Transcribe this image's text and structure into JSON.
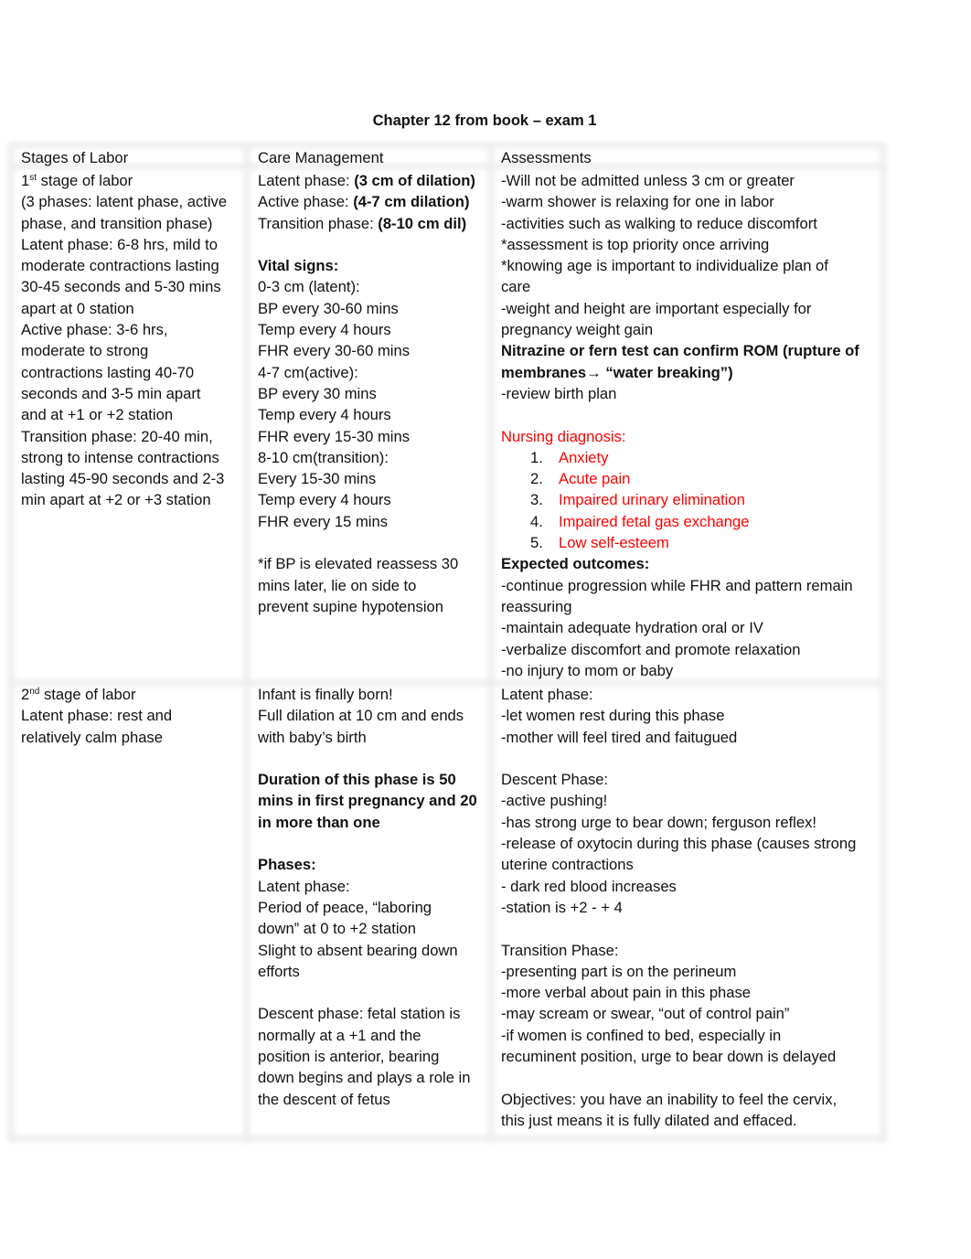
{
  "document": {
    "title": "Chapter 12 from book – exam 1"
  },
  "table": {
    "headers": [
      "Stages of Labor",
      "Care Management",
      "Assessments"
    ],
    "row1": {
      "stage": {
        "stage_num": "1",
        "stage_sup": "st",
        "stage_rest": " stage of labor",
        "lines": [
          "(3 phases: latent phase, active",
          "phase, and transition phase)",
          "Latent phase: 6-8 hrs, mild to",
          "moderate contractions lasting",
          "30-45 seconds and 5-30 mins",
          "apart at 0 station",
          "Active phase: 3-6 hrs,",
          "moderate to strong",
          "contractions lasting 40-70",
          "seconds and 3-5 min apart",
          "and at +1 or +2 station",
          "Transition phase: 20-40 min,",
          "strong to intense contractions",
          "lasting 45-90 seconds and 2-3",
          "min apart at +2 or +3 station"
        ]
      },
      "care": {
        "phases": [
          {
            "label": "Latent phase: ",
            "value": "(3 cm of dilation)"
          },
          {
            "label": "Active phase: ",
            "value": "(4-7 cm dilation)"
          },
          {
            "label": "Transition phase: ",
            "value": "(8-10 cm dil)"
          }
        ],
        "vitals_heading": "Vital signs:",
        "vitals": [
          "0-3 cm (latent):",
          "BP every 30-60 mins",
          "Temp every 4 hours",
          "FHR every 30-60 mins",
          "4-7 cm(active):",
          "BP every 30 mins",
          "Temp every 4 hours",
          "FHR every 15-30 mins",
          "8-10 cm(transition):",
          "Every 15-30 mins",
          "Temp every 4 hours",
          "FHR every 15 mins"
        ],
        "note": [
          "*if BP is elevated reassess 30",
          "mins later, lie on side to",
          "prevent supine hypotension"
        ]
      },
      "assess": {
        "lines": [
          "-Will not be admitted unless 3 cm or greater",
          "-warm shower is relaxing for one in labor",
          "-activities such as walking to reduce discomfort",
          "*assessment is top priority once arriving",
          "*knowing age is important to individualize plan of",
          "care",
          "-weight and height are important especially for",
          "pregnancy weight gain"
        ],
        "bold_line1": "Nitrazine or fern test can confirm ROM (rupture of",
        "bold_line2a": "membranes",
        "arrow": "→",
        "bold_line2b": " “water breaking”)",
        "review": "-review birth plan",
        "nursing_heading": "Nursing diagnosis:",
        "nursing_diagnoses": [
          {
            "num": "1.",
            "text": "Anxiety"
          },
          {
            "num": "2.",
            "text": "Acute pain"
          },
          {
            "num": "3.",
            "text": "Impaired urinary elimination"
          },
          {
            "num": "4.",
            "text": "Impaired fetal gas exchange"
          },
          {
            "num": "5.",
            "text": "Low self-esteem"
          }
        ],
        "outcomes_heading": "Expected outcomes:",
        "outcomes": [
          "-continue progression while FHR and pattern remain",
          "reassuring",
          "-maintain adequate hydration oral or IV",
          "-verbalize discomfort and promote relaxation",
          "-no injury to mom or baby"
        ]
      }
    },
    "row2": {
      "stage": {
        "stage_num": "2",
        "stage_sup": "nd",
        "stage_rest": " stage of labor",
        "lines": [
          "Latent phase: rest and",
          "relatively calm phase"
        ]
      },
      "care": {
        "intro": [
          "Infant is finally born!",
          "Full dilation at 10 cm and ends",
          "with baby’s birth"
        ],
        "duration": [
          "Duration of this phase is 50",
          "mins in first pregnancy and 20",
          "in more than one"
        ],
        "phases_heading": "Phases:",
        "latent": [
          "Latent phase:",
          "Period of peace, “laboring",
          "down” at 0 to +2 station",
          "Slight to absent bearing down",
          "efforts"
        ],
        "descent": [
          "Descent phase: fetal station is",
          "normally at a +1 and the",
          "position is anterior, bearing",
          "down begins and plays a role in",
          "the descent of fetus"
        ]
      },
      "assess": {
        "latent": [
          "Latent phase:",
          "-let women rest during this phase",
          "-mother will feel tired and faitugued"
        ],
        "descent": [
          "Descent Phase:",
          "-active pushing!",
          "-has strong urge to bear down; ferguson reflex!",
          "-release of oxytocin during this phase (causes strong",
          "uterine contractions",
          "- dark red blood increases",
          "-station is +2 - + 4"
        ],
        "transition": [
          "Transition Phase:",
          "-presenting part is on the perineum",
          "-more verbal about pain in this phase",
          "-may scream or swear, “out of control pain”",
          "-if women is confined to bed, especially in",
          "recuminent position, urge to bear down is delayed"
        ],
        "objectives": [
          "Objectives: you have an inability to feel the cervix,",
          "this just means it is fully dilated and effaced."
        ]
      }
    }
  },
  "colors": {
    "text": "#111111",
    "emphasis_red": "#ff0000",
    "border": "#ececec"
  }
}
